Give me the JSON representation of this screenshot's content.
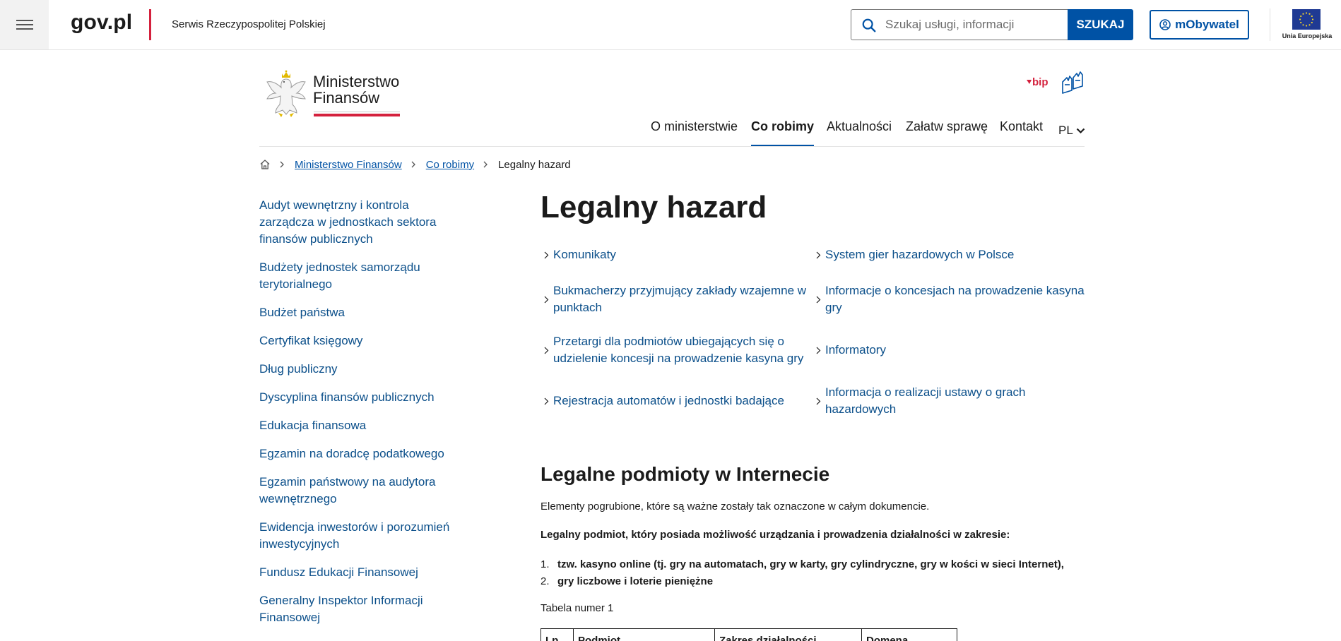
{
  "topbar": {
    "logo": "gov.pl",
    "tagline": "Serwis Rzeczypospolitej Polskiej",
    "search_placeholder": "Szukaj usługi, informacji",
    "search_button": "SZUKAJ",
    "mobywatel_button": "mObywatel",
    "eu_label": "Unia Europejska"
  },
  "ministry": {
    "name_line1": "Ministerstwo",
    "name_line2": "Finansów",
    "bip_label": "bip"
  },
  "nav": {
    "items": [
      "O ministerstwie",
      "Co robimy",
      "Aktualności",
      "Załatw sprawę",
      "Kontakt"
    ],
    "active_index": 1,
    "lang": "PL"
  },
  "breadcrumb": {
    "items": [
      "Ministerstwo Finansów",
      "Co robimy"
    ],
    "current": "Legalny hazard"
  },
  "sidebar": {
    "items": [
      "Audyt wewnętrzny i kontrola zarządcza w jednostkach sektora finansów publicznych",
      "Budżety jednostek samorządu terytorialnego",
      "Budżet państwa",
      "Certyfikat księgowy",
      "Dług publiczny",
      "Dyscyplina finansów publicznych",
      "Edukacja finansowa",
      "Egzamin na doradcę podatkowego",
      "Egzamin państwowy na audytora wewnętrznego",
      "Ewidencja inwestorów i porozumień inwestycyjnych",
      "Fundusz Edukacji Finansowej",
      "Generalny Inspektor Informacji Finansowej"
    ]
  },
  "main": {
    "title": "Legalny hazard",
    "links": [
      [
        "Komunikaty",
        "System gier hazardowych w Polsce"
      ],
      [
        "Bukmacherzy przyjmujący zakłady wzajemne w punktach",
        "Informacje o koncesjach na prowadzenie kasyna gry"
      ],
      [
        "Przetargi dla podmiotów ubiegających się o udzielenie koncesji na prowadzenie kasyna gry",
        "Informatory"
      ],
      [
        "Rejestracja automatów i jednostki badające",
        "Informacja o realizacji ustawy o grach hazardowych"
      ]
    ],
    "section_title": "Legalne podmioty w Internecie",
    "intro": "Elementy pogrubione, które są ważne zostały tak oznaczone w całym dokumencie.",
    "bold_intro": "Legalny podmiot, który posiada możliwość urządzania i prowadzenia działalności w zakresie:",
    "list": [
      "tzw. kasyno online (tj. gry na automatach, gry w karty, gry cylindryczne, gry w kości w  sieci Internet),",
      "gry liczbowe i loterie pieniężne"
    ],
    "table_caption": "Tabela numer 1",
    "table_headers": [
      "Lp.",
      "Podmiot",
      "Zakres działalności",
      "Domena"
    ]
  }
}
